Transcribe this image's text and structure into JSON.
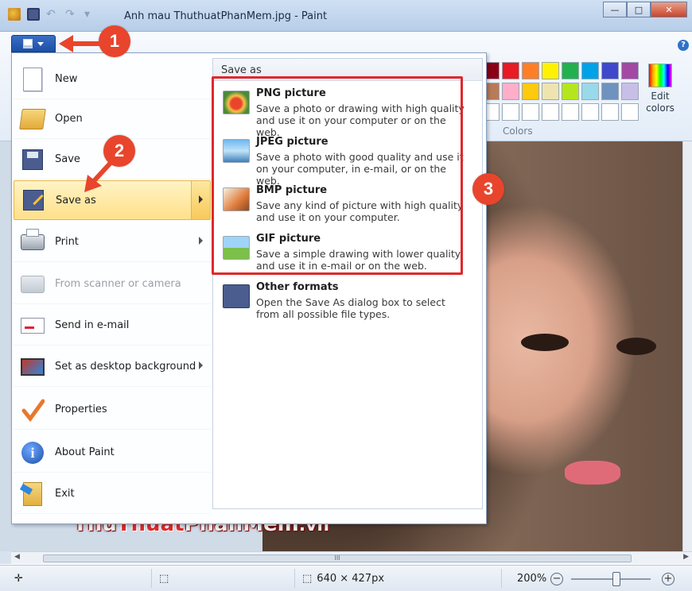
{
  "window": {
    "title": "Anh mau ThuthuatPhanMem.jpg - Paint",
    "minimize": "—",
    "maximize": "□",
    "close": "✕"
  },
  "ribbon": {
    "colors_label": "Colors",
    "edit_colors_label": "Edit colors",
    "help": "?",
    "swatches_row1": [
      "#8b0015",
      "#e81a23",
      "#ff7f27",
      "#fff200",
      "#22b14c",
      "#00a2e8",
      "#3f48cc",
      "#a349a4"
    ],
    "swatches_row2": [
      "#b97a57",
      "#ffaec9",
      "#ffc90e",
      "#efe4b0",
      "#b5e61d",
      "#99d9ea",
      "#7092be",
      "#c8bfe7"
    ],
    "swatches_row3": [
      "#ffffff",
      "#ffffff",
      "#ffffff",
      "#ffffff",
      "#ffffff",
      "#ffffff",
      "#ffffff",
      "#ffffff"
    ]
  },
  "file_menu": {
    "items": [
      {
        "label": "New",
        "icon": "new-document-icon",
        "has_submenu": false,
        "disabled": false
      },
      {
        "label": "Open",
        "icon": "open-folder-icon",
        "has_submenu": false,
        "disabled": false
      },
      {
        "label": "Save",
        "icon": "save-disk-icon",
        "has_submenu": false,
        "disabled": false
      },
      {
        "label": "Save as",
        "icon": "save-as-icon",
        "has_submenu": true,
        "disabled": false,
        "active": true
      },
      {
        "label": "Print",
        "icon": "printer-icon",
        "has_submenu": true,
        "disabled": false
      },
      {
        "label": "From scanner or camera",
        "icon": "scanner-icon",
        "has_submenu": false,
        "disabled": true
      },
      {
        "label": "Send in e-mail",
        "icon": "email-icon",
        "has_submenu": false,
        "disabled": false
      },
      {
        "label": "Set as desktop background",
        "icon": "desktop-icon",
        "has_submenu": true,
        "disabled": false
      },
      {
        "label": "Properties",
        "icon": "checkmark-icon",
        "has_submenu": false,
        "disabled": false
      },
      {
        "label": "About Paint",
        "icon": "info-icon",
        "has_submenu": false,
        "disabled": false
      },
      {
        "label": "Exit",
        "icon": "exit-icon",
        "has_submenu": false,
        "disabled": false
      }
    ]
  },
  "save_as_submenu": {
    "header": "Save as",
    "items": [
      {
        "title": "PNG picture",
        "desc": "Save a photo or drawing with high quality and use it on your computer or on the web.",
        "icon": "png-picture-icon"
      },
      {
        "title": "JPEG picture",
        "desc": "Save a photo with good quality and use it on your computer, in e-mail, or on the web.",
        "icon": "jpeg-picture-icon"
      },
      {
        "title": "BMP picture",
        "desc": "Save any kind of picture with high quality and use it on your computer.",
        "icon": "bmp-picture-icon"
      },
      {
        "title": "GIF picture",
        "desc": "Save a simple drawing with lower quality and use it in e-mail or on the web.",
        "icon": "gif-picture-icon"
      },
      {
        "title": "Other formats",
        "desc": "Open the Save As dialog box to select from all possible file types.",
        "icon": "other-formats-icon"
      }
    ]
  },
  "callouts": [
    "1",
    "2",
    "3"
  ],
  "watermark": {
    "part1": "Thu",
    "part2": "Thuat",
    "part3": "PhanMem",
    "part4": ".vn"
  },
  "statusbar": {
    "image_size": "640 × 427px",
    "zoom": "200%",
    "zoom_out": "−",
    "zoom_in": "+",
    "scroll_thumb": "III"
  },
  "colors": {
    "accent": "#1c4fa6",
    "callout": "#e8452c",
    "highlight_border": "#e0282b",
    "active_item": "#ffe08a"
  }
}
